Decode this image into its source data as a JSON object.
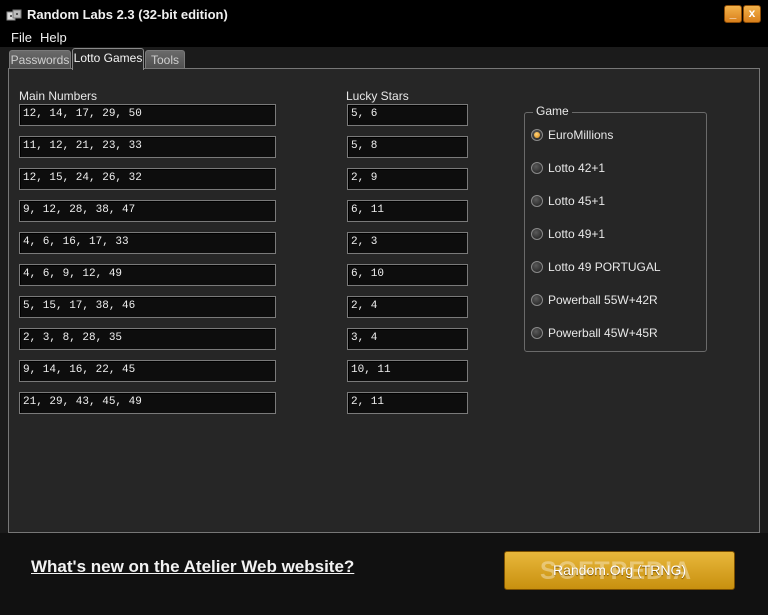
{
  "window": {
    "title": "Random Labs 2.3 (32-bit edition)",
    "minimize": "_",
    "close": "x",
    "icon": "dice-app-icon"
  },
  "menu": [
    "File",
    "Help"
  ],
  "tabs": [
    "Passwords",
    "Lotto Games",
    "Tools"
  ],
  "active_tab": "Lotto Games",
  "labels": {
    "main_numbers": "Main Numbers",
    "lucky_stars": "Lucky Stars",
    "game": "Game"
  },
  "draws": [
    {
      "main": "12, 14, 17, 29, 50",
      "stars": "5, 6"
    },
    {
      "main": "11, 12, 21, 23, 33",
      "stars": "5, 8"
    },
    {
      "main": "12, 15, 24, 26, 32",
      "stars": "2, 9"
    },
    {
      "main": "9, 12, 28, 38, 47",
      "stars": "6, 11"
    },
    {
      "main": "4, 6, 16, 17, 33",
      "stars": "2, 3"
    },
    {
      "main": "4, 6, 9, 12, 49",
      "stars": "6, 10"
    },
    {
      "main": "5, 15, 17, 38, 46",
      "stars": "2, 4"
    },
    {
      "main": "2, 3, 8, 28, 35",
      "stars": "3, 4"
    },
    {
      "main": "9, 14, 16, 22, 45",
      "stars": "10, 11"
    },
    {
      "main": "21, 29, 43, 45, 49",
      "stars": "2, 11"
    }
  ],
  "games": [
    {
      "label": "EuroMillions",
      "checked": true
    },
    {
      "label": "Lotto 42+1",
      "checked": false
    },
    {
      "label": "Lotto 45+1",
      "checked": false
    },
    {
      "label": "Lotto 49+1",
      "checked": false
    },
    {
      "label": "Lotto 49 PORTUGAL",
      "checked": false
    },
    {
      "label": "Powerball 55W+42R",
      "checked": false
    },
    {
      "label": "Powerball 45W+45R",
      "checked": false
    }
  ],
  "footer": {
    "whats_new": "What's new on the Atelier Web website?",
    "rng_button": "Random.Org (TRNG)",
    "watermark": "SOFTPEDIA"
  },
  "colors": {
    "accent": "#d99a1f",
    "panel": "#262626",
    "field": "#0d0d0d"
  }
}
